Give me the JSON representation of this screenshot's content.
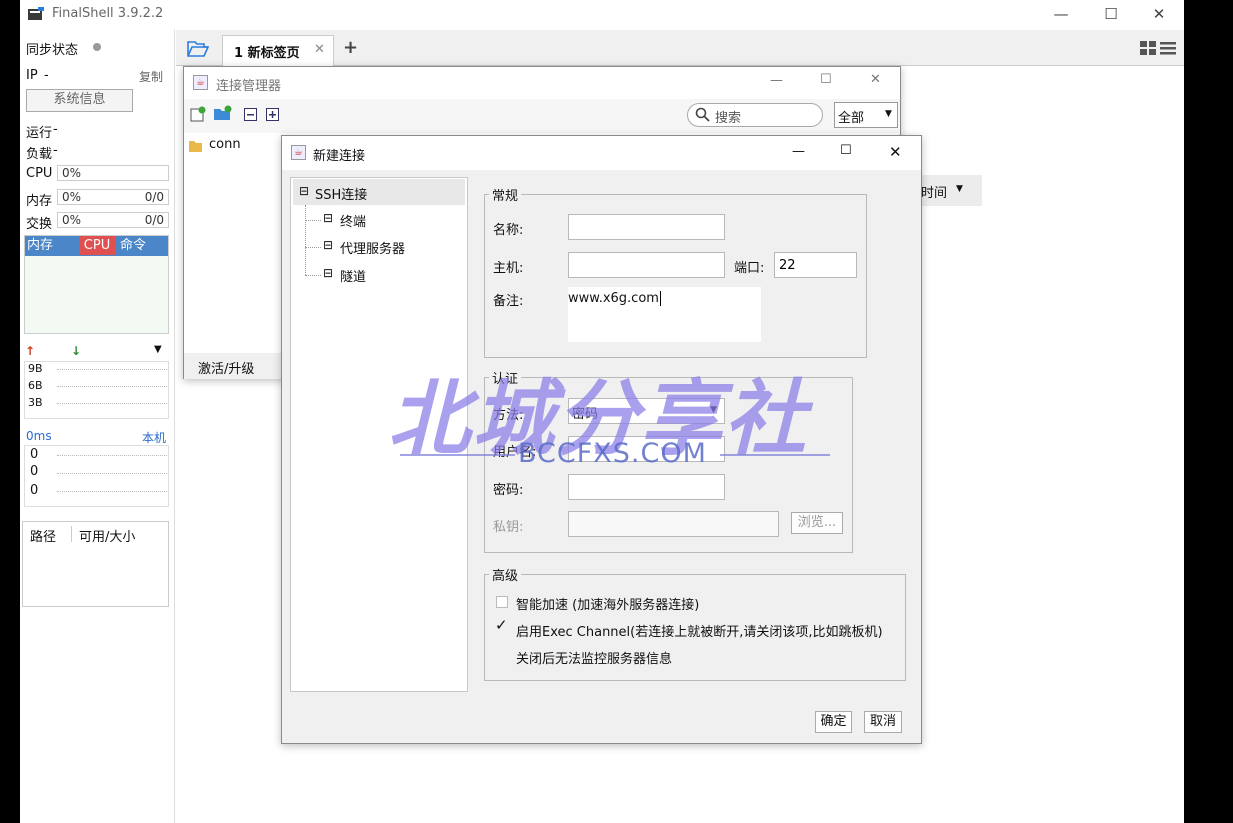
{
  "app": {
    "title": "FinalShell 3.9.2.2"
  },
  "sidebar": {
    "sync_label": "同步状态",
    "ip_label": "IP",
    "ip_value": "-",
    "copy_label": "复制",
    "sysinfo_button": "系统信息",
    "run_label": "运行",
    "run_value": "-",
    "load_label": "负载",
    "load_value": "-",
    "cpu_label": "CPU",
    "cpu_value": "0%",
    "mem_label": "内存",
    "mem_value": "0%",
    "mem_extra": "0/0",
    "swap_label": "交换",
    "swap_value": "0%",
    "swap_extra": "0/0",
    "proc_headers": [
      "内存",
      "CPU",
      "命令"
    ],
    "net_labels": [
      "9B",
      "6B",
      "3B"
    ],
    "latency_label": "0ms",
    "latency_host": "本机",
    "latency_values": [
      "0",
      "0",
      "0"
    ],
    "disk_headers": [
      "路径",
      "可用/大小"
    ]
  },
  "tabs": [
    {
      "label": "1 新标签页"
    }
  ],
  "conn_manager": {
    "title": "连接管理器",
    "search_placeholder": "搜索",
    "filter_value": "全部",
    "items": [
      {
        "label": "conn"
      }
    ],
    "footer_button": "激活/升级",
    "sort_label": "时间"
  },
  "new_conn": {
    "title": "新建连接",
    "tree": {
      "root": "SSH连接",
      "children": [
        "终端",
        "代理服务器",
        "隧道"
      ]
    },
    "general": {
      "title": "常规",
      "name_label": "名称:",
      "name_value": "",
      "host_label": "主机:",
      "host_value": "",
      "port_label": "端口:",
      "port_value": "22",
      "note_label": "备注:",
      "note_value": "www.x6g.com"
    },
    "auth": {
      "title": "认证",
      "method_label": "方法:",
      "method_value": "密码",
      "user_label": "用户名:",
      "user_value": "",
      "pass_label": "密码:",
      "pass_value": "",
      "key_label": "私钥:",
      "key_value": "",
      "browse_button": "浏览..."
    },
    "advanced": {
      "title": "高级",
      "accel_label": "智能加速 (加速海外服务器连接)",
      "accel_checked": false,
      "exec_label": "启用Exec Channel(若连接上就被断开,请关闭该项,比如跳板机)",
      "exec_checked": true,
      "exec_note": "关闭后无法监控服务器信息"
    },
    "ok_button": "确定",
    "cancel_button": "取消"
  },
  "watermark": {
    "title": "北城分享社",
    "subtitle": "BCCFXS.COM"
  },
  "colors": {
    "cpu_highlight": "#e05050",
    "proc_header": "#4a86c8",
    "watermark": "#8a7ee8"
  }
}
